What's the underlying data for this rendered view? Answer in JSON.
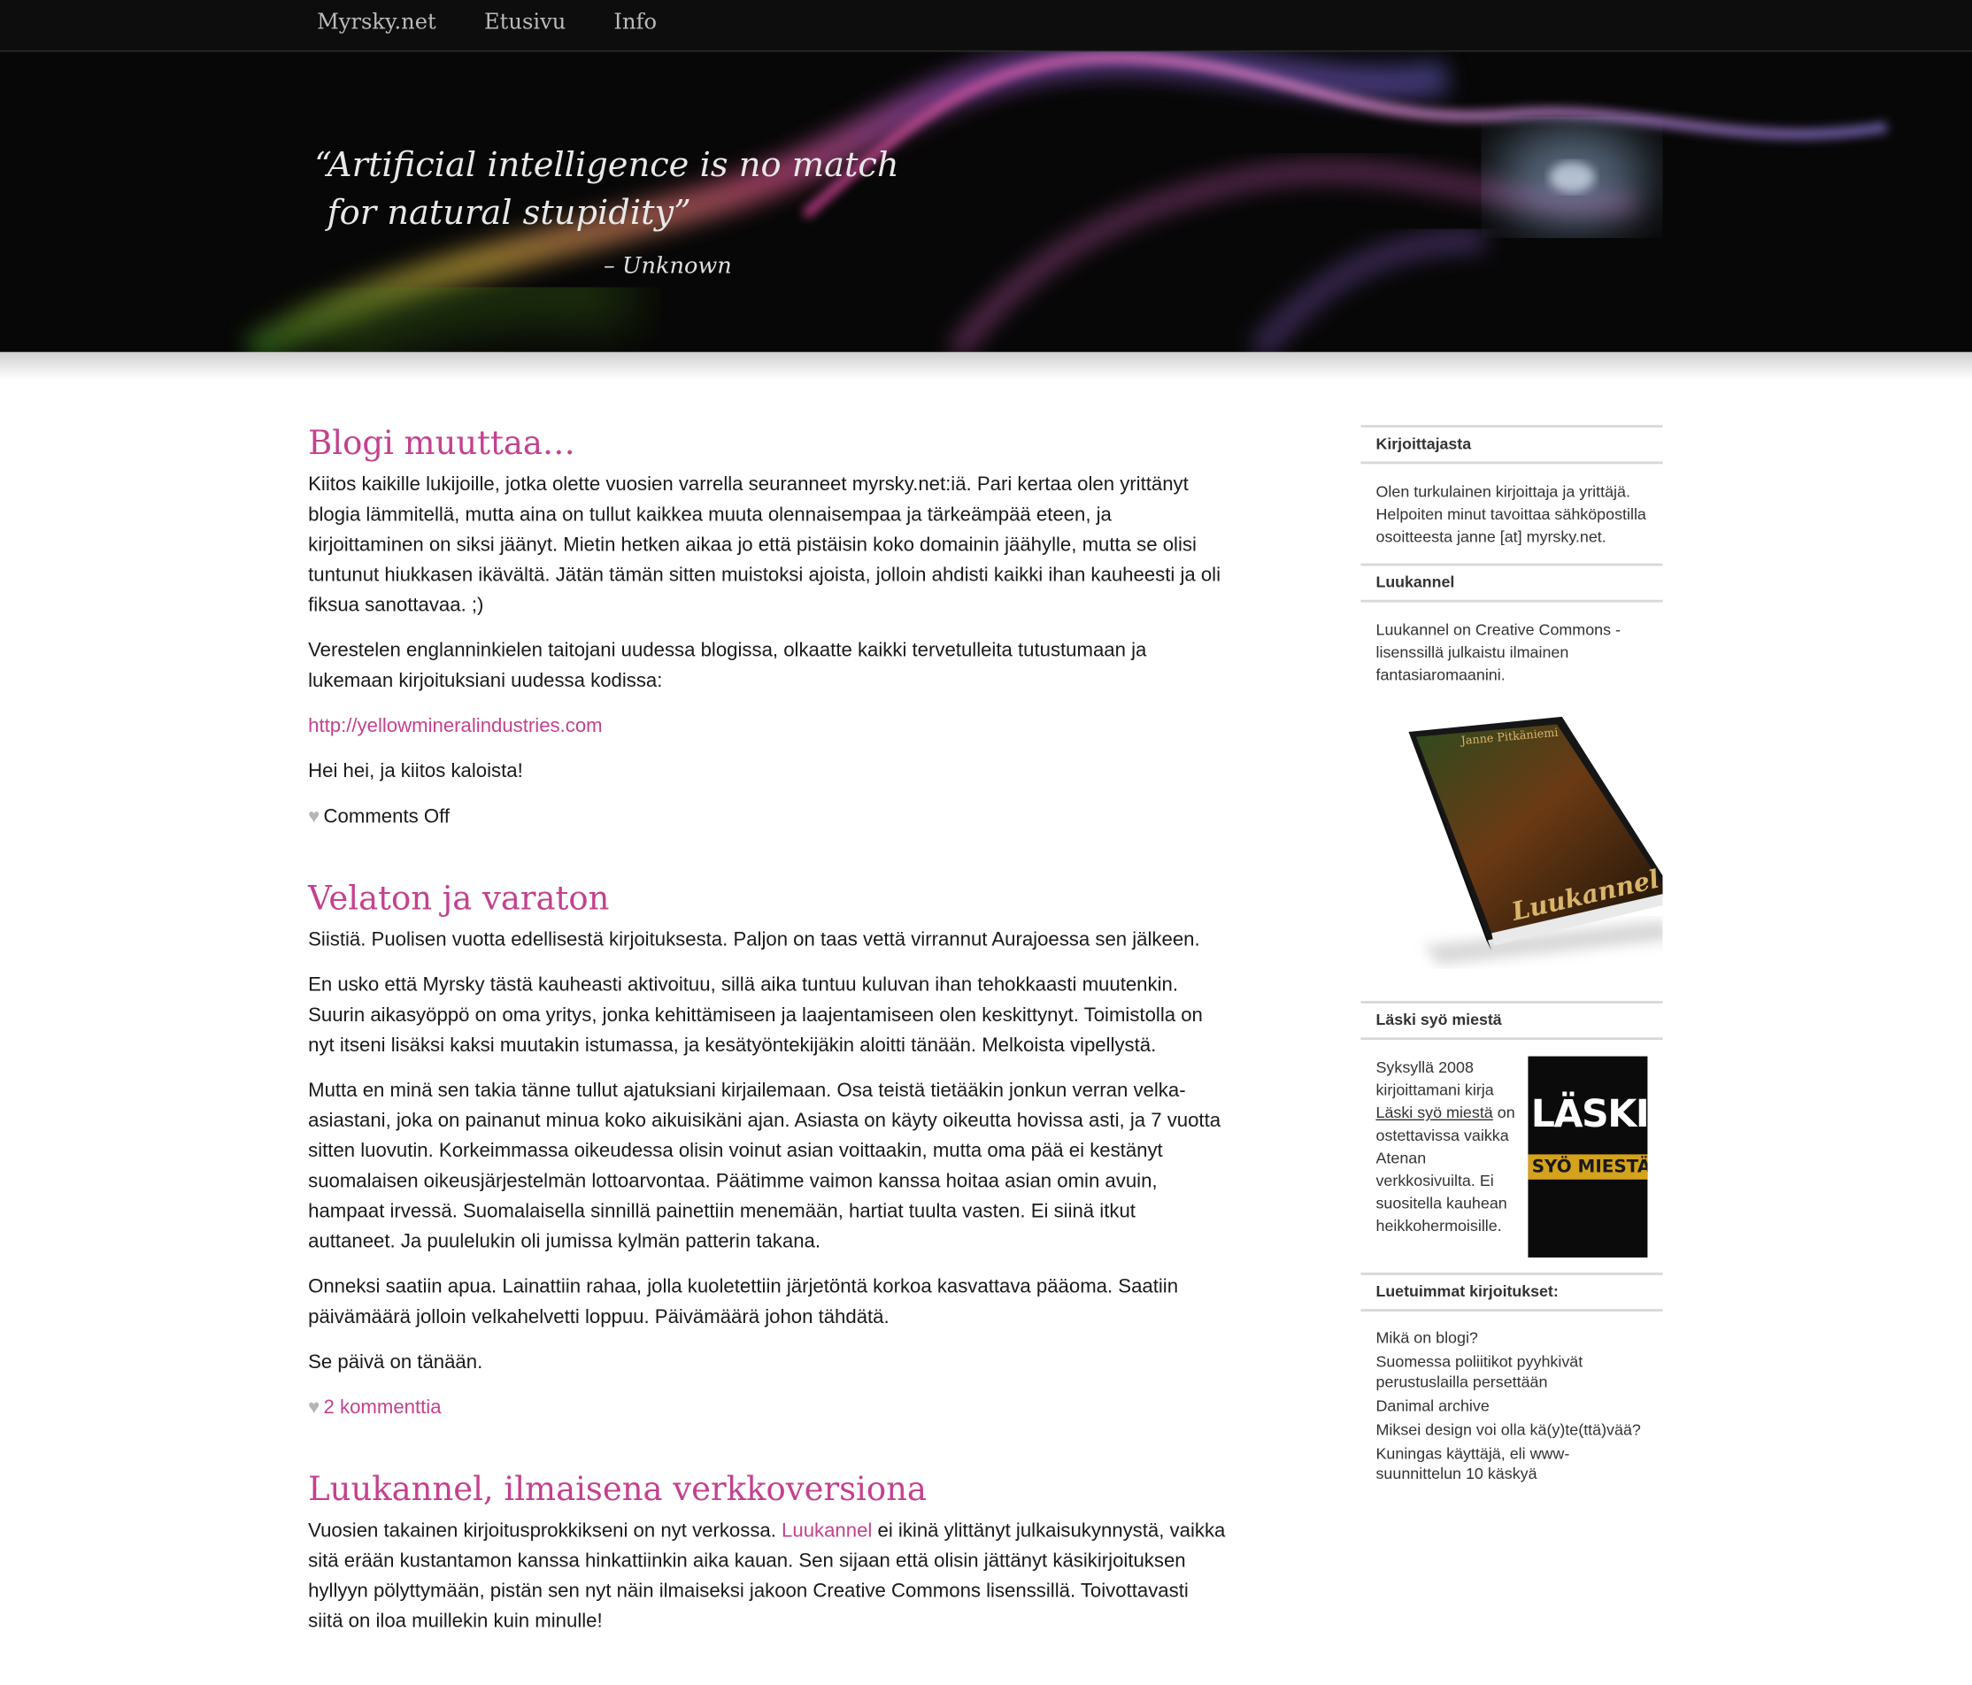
{
  "nav": {
    "items": [
      "Myrsky.net",
      "Etusivu",
      "Info"
    ]
  },
  "banner": {
    "quote_line1": "“Artificial intelligence is no match",
    "quote_line2": "for natural stupidity”",
    "attribution": "– Unknown"
  },
  "posts": [
    {
      "title": "Blogi muuttaa…",
      "paragraphs": [
        "Kiitos kaikille lukijoille, jotka olette vuosien varrella seuranneet myrsky.net:iä. Pari kertaa olen yrittänyt blogia lämmitellä, mutta aina on tullut kaikkea muuta olennaisempaa ja tärkeämpää eteen, ja kirjoittaminen on siksi jäänyt. Mietin hetken aikaa jo että pistäisin koko domainin jäähylle, mutta se olisi tuntunut hiukkasen ikävältä. Jätän tämän sitten muistoksi ajoista, jolloin ahdisti kaikki ihan kauheesti ja oli fiksua sanottavaa. ;)",
        "Verestelen englanninkielen taitojani uudessa blogissa, olkaatte kaikki tervetulleita tutustumaan ja lukemaan kirjoituksiani uudessa kodissa:"
      ],
      "link": "http://yellowmineralindustries.com",
      "closing": "Hei hei, ja kiitos kaloista!",
      "meta_icon": "heart-icon",
      "meta": "Comments Off"
    },
    {
      "title": "Velaton ja varaton",
      "paragraphs": [
        "Siistiä. Puolisen vuotta edellisestä kirjoituksesta. Paljon on taas vettä virrannut Aurajoessa sen jälkeen.",
        "En usko että Myrsky tästä kauheasti aktivoituu, sillä aika tuntuu kuluvan ihan tehokkaasti muutenkin. Suurin aikasyöppö on oma yritys, jonka kehittämiseen ja laajentamiseen olen keskittynyt. Toimistolla on nyt itseni lisäksi kaksi muutakin istumassa, ja kesätyöntekijäkin aloitti tänään. Melkoista vipellystä.",
        "Mutta en minä sen takia tänne tullut ajatuksiani kirjailemaan. Osa teistä tietääkin jonkun verran velka-asiastani, joka on painanut minua koko aikuisikäni ajan. Asiasta on käyty oikeutta hovissa asti, ja 7 vuotta sitten luovutin. Korkeimmassa oikeudessa olisin voinut asian voittaakin, mutta oma pää ei kestänyt suomalaisen oikeusjärjestelmän lottoarvontaa. Päätimme vaimon kanssa hoitaa asian omin avuin, hampaat irvessä. Suomalaisella sinnillä painettiin menemään, hartiat tuulta vasten. Ei siinä itkut auttaneet. Ja puulelukin oli jumissa kylmän patterin takana.",
        "Onneksi saatiin apua. Lainattiin rahaa, jolla kuoletettiin järjetöntä korkoa kasvattava pääoma. Saatiin päivämäärä jolloin velkahelvetti loppuu. Päivämäärä johon tähdätä.",
        "Se päivä on tänään."
      ],
      "meta_icon": "heart-icon",
      "meta": "2 kommenttia"
    },
    {
      "title": "Luukannel, ilmaisena verkkoversiona",
      "text_before_link": "Vuosien takainen kirjoitusprokkikseni on nyt verkossa. ",
      "link": "Luukannel",
      "text_after_link": " ei ikinä ylittänyt julkaisukynnystä, vaikka sitä erään kustantamon kanssa hinkattiinkin aika kauan. Sen sijaan että olisin jättänyt käsikirjoituksen hyllyyn pölyttymään, pistän sen nyt näin ilmaiseksi jakoon Creative Commons lisenssillä. Toivottavasti siitä on iloa muillekin kuin minulle!"
    }
  ],
  "sidebar": {
    "about_title": "Kirjoittajasta",
    "about_text": "Olen turkulainen kirjoittaja ja yrittäjä. Helpoiten minut tavoittaa sähköpostilla osoitteesta janne [at] myrsky.net.",
    "luukannel_title": "Luukannel",
    "luukannel_text": "Luukannel on Creative Commons -lisenssillä julkaistu ilmainen fantasiaromaanini.",
    "book_author": "Janne Pitkäniemi",
    "book_title": "Luukannel",
    "laski_title": "Läski syö miestä",
    "laski_text_before": "Syksyllä 2008 kirjoittamani kirja ",
    "laski_link": "Läski syö miestä",
    "laski_text_after": " on ostettavissa vaikka Atenan verkkosivuilta. Ei suositella kauhean heikkohermoisille.",
    "laski_cover_line1": "LÄSKI",
    "laski_cover_line2": "SYÖ MIESTÄ",
    "popular_title": "Luetuimmat kirjoitukset:",
    "popular": [
      "Mikä on blogi?",
      "Suomessa poliitikot pyyhkivät perustuslailla persettään",
      "Danimal archive",
      "Miksei design voi olla kä(y)te(ttä)vää?",
      "Kuningas käyttäjä, eli www-suunnittelun 10 käskyä"
    ]
  },
  "colors": {
    "accent": "#c4418f",
    "nav_bg": "#0d0d0d",
    "banner_bg": "#070707"
  }
}
